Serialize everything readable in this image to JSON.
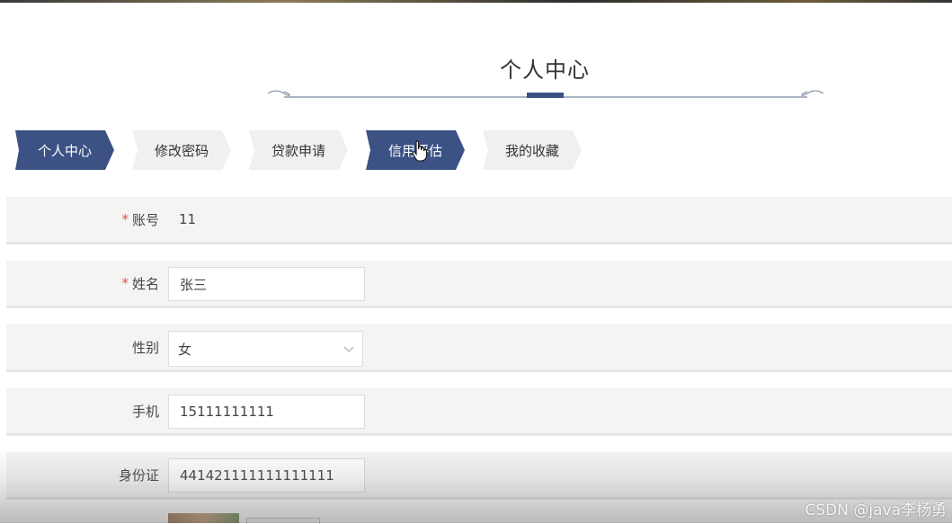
{
  "page": {
    "title": "个人中心"
  },
  "tabs": [
    {
      "label": "个人中心",
      "active": true
    },
    {
      "label": "修改密码",
      "active": false
    },
    {
      "label": "贷款申请",
      "active": false
    },
    {
      "label": "信用评估",
      "active": true
    },
    {
      "label": "我的收藏",
      "active": false
    }
  ],
  "form": {
    "account": {
      "label": "账号",
      "required": "*",
      "value": "11"
    },
    "name": {
      "label": "姓名",
      "required": "*",
      "value": "张三"
    },
    "gender": {
      "label": "性别",
      "value": "女",
      "icon": "chevron-down-icon"
    },
    "phone": {
      "label": "手机",
      "value": "15111111111"
    },
    "id_card": {
      "label": "身份证",
      "value": "441421111111111111"
    }
  },
  "watermark": "CSDN @java李杨勇",
  "colors": {
    "accent": "#3c5285",
    "row_bg": "#f4f4f2",
    "required": "#d9534f"
  }
}
